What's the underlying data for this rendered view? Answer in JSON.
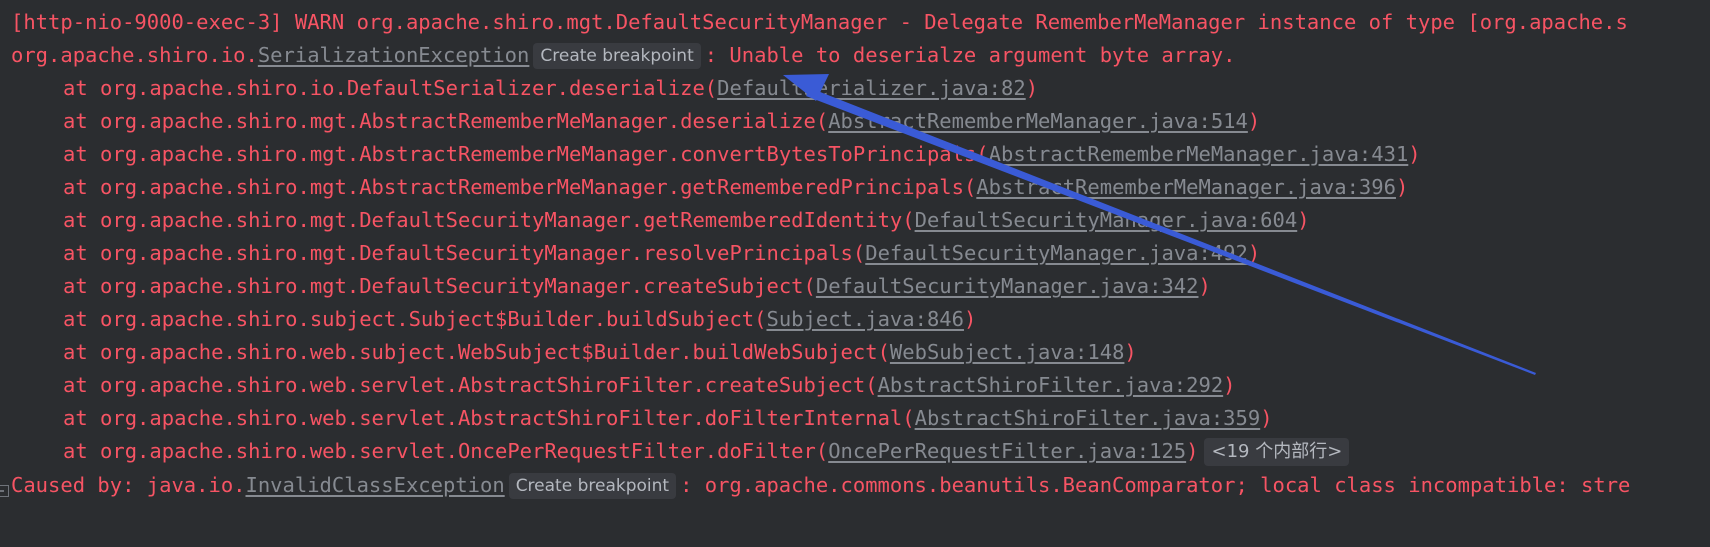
{
  "console": {
    "warn_line": "[http-nio-9000-exec-3] WARN org.apache.shiro.mgt.DefaultSecurityManager - Delegate RememberMeManager instance of type [org.apache.s",
    "exception": {
      "package": "org.apache.shiro.io.",
      "class_link": "SerializationException",
      "breakpoint_label": "Create breakpoint",
      "message": ": Unable to deserialze argument byte array."
    },
    "frames": [
      {
        "method": "at org.apache.shiro.io.DefaultSerializer.deserialize(",
        "link": "DefaultSerializer.java:82",
        "close": ")"
      },
      {
        "method": "at org.apache.shiro.mgt.AbstractRememberMeManager.deserialize(",
        "link": "AbstractRememberMeManager.java:514",
        "close": ")"
      },
      {
        "method": "at org.apache.shiro.mgt.AbstractRememberMeManager.convertBytesToPrincipals(",
        "link": "AbstractRememberMeManager.java:431",
        "close": ")"
      },
      {
        "method": "at org.apache.shiro.mgt.AbstractRememberMeManager.getRememberedPrincipals(",
        "link": "AbstractRememberMeManager.java:396",
        "close": ")"
      },
      {
        "method": "at org.apache.shiro.mgt.DefaultSecurityManager.getRememberedIdentity(",
        "link": "DefaultSecurityManager.java:604",
        "close": ")"
      },
      {
        "method": "at org.apache.shiro.mgt.DefaultSecurityManager.resolvePrincipals(",
        "link": "DefaultSecurityManager.java:492",
        "close": ")"
      },
      {
        "method": "at org.apache.shiro.mgt.DefaultSecurityManager.createSubject(",
        "link": "DefaultSecurityManager.java:342",
        "close": ")"
      },
      {
        "method": "at org.apache.shiro.subject.Subject$Builder.buildSubject(",
        "link": "Subject.java:846",
        "close": ")"
      },
      {
        "method": "at org.apache.shiro.web.subject.WebSubject$Builder.buildWebSubject(",
        "link": "WebSubject.java:148",
        "close": ")"
      },
      {
        "method": "at org.apache.shiro.web.servlet.AbstractShiroFilter.createSubject(",
        "link": "AbstractShiroFilter.java:292",
        "close": ")"
      },
      {
        "method": "at org.apache.shiro.web.servlet.AbstractShiroFilter.doFilterInternal(",
        "link": "AbstractShiroFilter.java:359",
        "close": ")"
      },
      {
        "method": "at org.apache.shiro.web.servlet.OncePerRequestFilter.doFilter(",
        "link": "OncePerRequestFilter.java:125",
        "close": ")",
        "folded": "<19 个内部行>"
      }
    ],
    "caused_by": {
      "prefix": "Caused by: java.io.",
      "class_link": "InvalidClassException",
      "breakpoint_label": "Create breakpoint",
      "message": ": org.apache.commons.beanutils.BeanComparator; local class incompatible: stre"
    },
    "colors": {
      "background": "#2b2d30",
      "error_text": "#f75464",
      "link_text": "#868a91",
      "annotation_arrow": "#3a5bd6"
    }
  }
}
